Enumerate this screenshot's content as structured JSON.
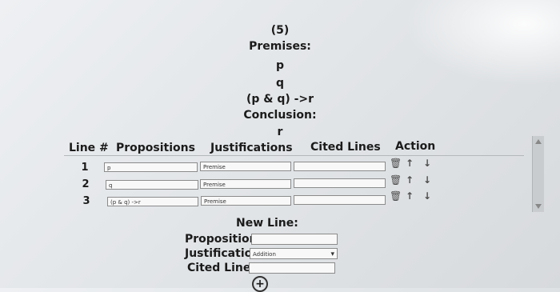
{
  "problem": {
    "number": "(5)",
    "premises_label": "Premises:",
    "premises": [
      "p",
      "q",
      "(p & q) ->r"
    ],
    "conclusion_label": "Conclusion:",
    "conclusion": "r"
  },
  "table": {
    "headers": {
      "line": "Line #",
      "propositions": "Propositions",
      "justifications": "Justifications",
      "cited_lines": "Cited Lines",
      "action": "Action"
    },
    "rows": [
      {
        "line": "1",
        "proposition": "p",
        "justification": "Premise",
        "cited": ""
      },
      {
        "line": "2",
        "proposition": "q",
        "justification": "Premise",
        "cited": ""
      },
      {
        "line": "3",
        "proposition": "(p & q) ->r",
        "justification": "Premise",
        "cited": ""
      }
    ]
  },
  "new_line": {
    "title": "New Line:",
    "proposition_label": "Proposition:",
    "proposition_value": "",
    "justification_label": "Justification:",
    "justification_selected": "Addition",
    "cited_label": "Cited Lines:",
    "cited_value": ""
  },
  "icons": {
    "delete": "trash-icon",
    "move_up": "arrow-up-icon",
    "move_down": "arrow-down-icon",
    "add": "plus-circle-icon"
  }
}
